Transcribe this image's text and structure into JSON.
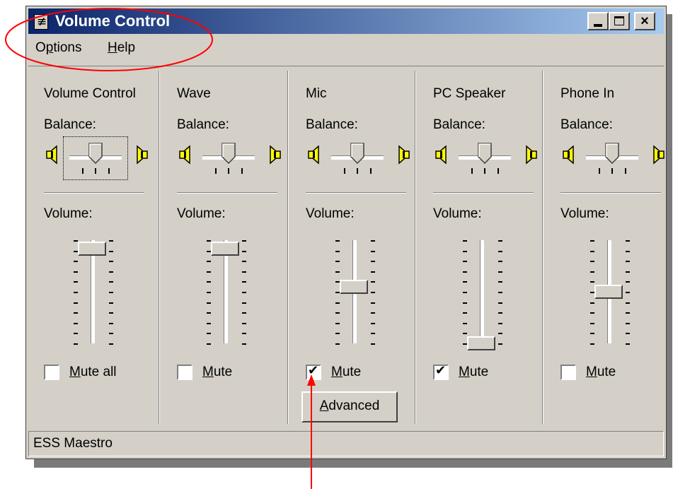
{
  "window": {
    "title": "Volume Control"
  },
  "menu": {
    "items": [
      "Options",
      "Help"
    ]
  },
  "columns": [
    {
      "name": "Volume Control",
      "balance_label": "Balance:",
      "volume_label": "Volume:",
      "balance": 0.5,
      "volume": 0.92,
      "mute_label": "Mute all",
      "muted": false
    },
    {
      "name": "Wave",
      "balance_label": "Balance:",
      "volume_label": "Volume:",
      "balance": 0.5,
      "volume": 0.92,
      "mute_label": "Mute",
      "muted": false
    },
    {
      "name": "Mic",
      "balance_label": "Balance:",
      "volume_label": "Volume:",
      "balance": 0.5,
      "volume": 0.55,
      "mute_label": "Mute",
      "muted": true,
      "advanced_label": "Advanced"
    },
    {
      "name": "PC Speaker",
      "balance_label": "Balance:",
      "volume_label": "Volume:",
      "balance": 0.5,
      "volume": 0.0,
      "mute_label": "Mute",
      "muted": true
    },
    {
      "name": "Phone In",
      "balance_label": "Balance:",
      "volume_label": "Volume:",
      "balance": 0.5,
      "volume": 0.5,
      "mute_label": "Mute",
      "muted": false
    }
  ],
  "status": {
    "text": "ESS Maestro"
  },
  "colors": {
    "title_start": "#0a246a",
    "title_end": "#a6caf0",
    "face": "#d4d0c8",
    "annotation": "#ff0000",
    "speaker": "#ffff00"
  },
  "icons": {
    "app": "volume-control-icon",
    "speaker_left": "speaker-left-icon",
    "speaker_right": "speaker-right-icon"
  }
}
